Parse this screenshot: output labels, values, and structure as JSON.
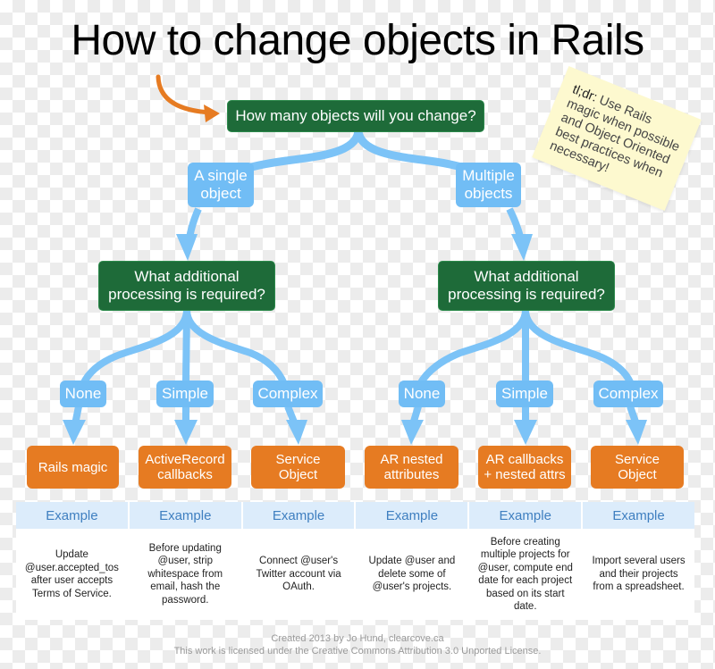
{
  "title": "How to change objects in Rails",
  "colors": {
    "question_bg": "#1e6b39",
    "branch_label_bg": "#71bdf5",
    "flow_arrow": "#7cc3f7",
    "outcome_bg": "#e67b22",
    "start_arrow": "#e67b22",
    "example_header_bg": "#dcecfb",
    "example_header_text": "#3f7fc0",
    "note_bg": "#fdf9cf"
  },
  "start_question": "How many objects will you change?",
  "note": {
    "prefix": "tl;dr:",
    "text": "Use Rails magic when possible and Object Oriented best practices when necessary!"
  },
  "branches": [
    {
      "label": "A single object",
      "question": "What additional processing is required?",
      "options": [
        {
          "label": "None",
          "outcome": "Rails magic",
          "example_header": "Example",
          "example": "Update @user.accepted_tos after user accepts Terms of Service."
        },
        {
          "label": "Simple",
          "outcome": "ActiveRecord callbacks",
          "example_header": "Example",
          "example": "Before updating @user, strip whitespace from email, hash the password."
        },
        {
          "label": "Complex",
          "outcome": "Service Object",
          "example_header": "Example",
          "example": "Connect @user's Twitter account via OAuth."
        }
      ]
    },
    {
      "label": "Multiple objects",
      "question": "What additional processing is required?",
      "options": [
        {
          "label": "None",
          "outcome": "AR nested attributes",
          "example_header": "Example",
          "example": "Update @user and delete some of @user's projects."
        },
        {
          "label": "Simple",
          "outcome": "AR callbacks + nested attrs",
          "example_header": "Example",
          "example": "Before creating multiple projects for @user, compute end date for each project based on its start date."
        },
        {
          "label": "Complex",
          "outcome": "Service Object",
          "example_header": "Example",
          "example": "Import several users and their projects from a spreadsheet."
        }
      ]
    }
  ],
  "credits": {
    "line1": "Created 2013 by Jo Hund, clearcove.ca",
    "line2": "This work is licensed under the Creative Commons Attribution 3.0 Unported License."
  }
}
